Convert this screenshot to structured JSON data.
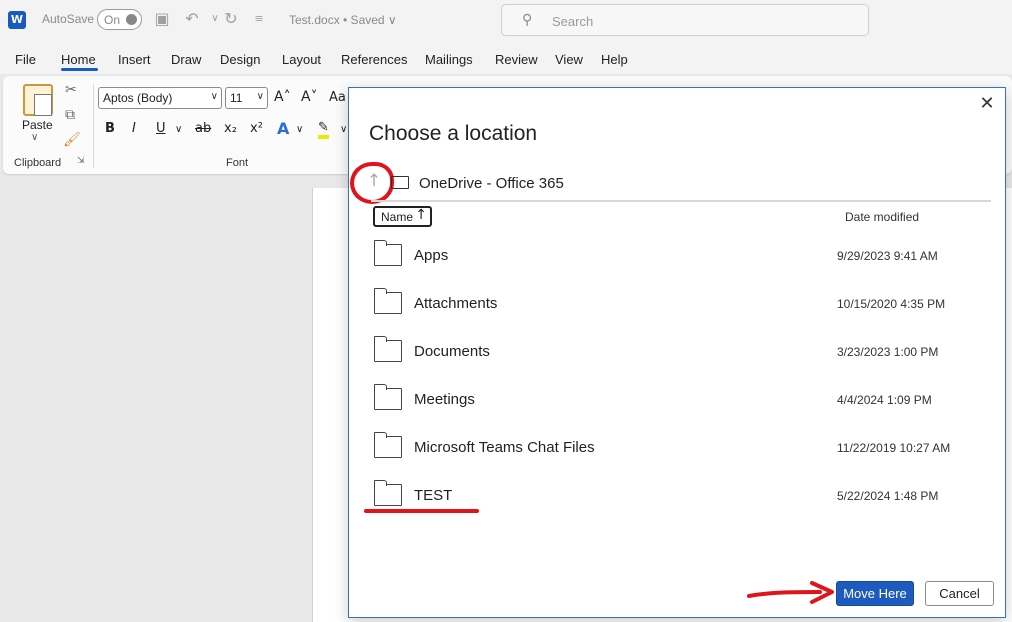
{
  "titlebar": {
    "app_logo": "W",
    "autosave_label": "AutoSave",
    "autosave_state": "On",
    "doc_title": "Test.docx • Saved ∨",
    "search_placeholder": "Search",
    "icons": [
      "word-icon",
      "save-icon",
      "undo-icon",
      "redo-icon",
      "customize-icon",
      "search-icon"
    ]
  },
  "menu": {
    "tabs": [
      "File",
      "Home",
      "Insert",
      "Draw",
      "Design",
      "Layout",
      "References",
      "Mailings",
      "Review",
      "View",
      "Help"
    ],
    "active": "Home"
  },
  "ribbon": {
    "paste_label": "Paste",
    "clipboard_label": "Clipboard",
    "font_label": "Font",
    "font_name": "Aptos (Body)",
    "font_size": "11",
    "grow_font": "A˄",
    "shrink_font": "A˅",
    "change_case": "Aa",
    "bold": "B",
    "italic": "I",
    "underline": "U",
    "strike": "ab",
    "subscript": "x₂",
    "superscript": "x²",
    "text_effects": "A",
    "highlight": "✎"
  },
  "dialog": {
    "title": "Choose a location",
    "breadcrumb": "OneDrive - Office 365",
    "col_name": "Name",
    "col_date": "Date modified",
    "rows": [
      {
        "name": "Apps",
        "date": "9/29/2023 9:41 AM"
      },
      {
        "name": "Attachments",
        "date": "10/15/2020 4:35 PM"
      },
      {
        "name": "Documents",
        "date": "3/23/2023 1:00 PM"
      },
      {
        "name": "Meetings",
        "date": "4/4/2024 1:09 PM"
      },
      {
        "name": "Microsoft Teams Chat Files",
        "date": "11/22/2019 10:27 AM"
      },
      {
        "name": "TEST",
        "date": "5/22/2024 1:48 PM"
      }
    ],
    "primary_button": "Move Here",
    "cancel_button": "Cancel"
  },
  "colors": {
    "accent": "#1d5bbf",
    "annotation": "#e0141b"
  }
}
